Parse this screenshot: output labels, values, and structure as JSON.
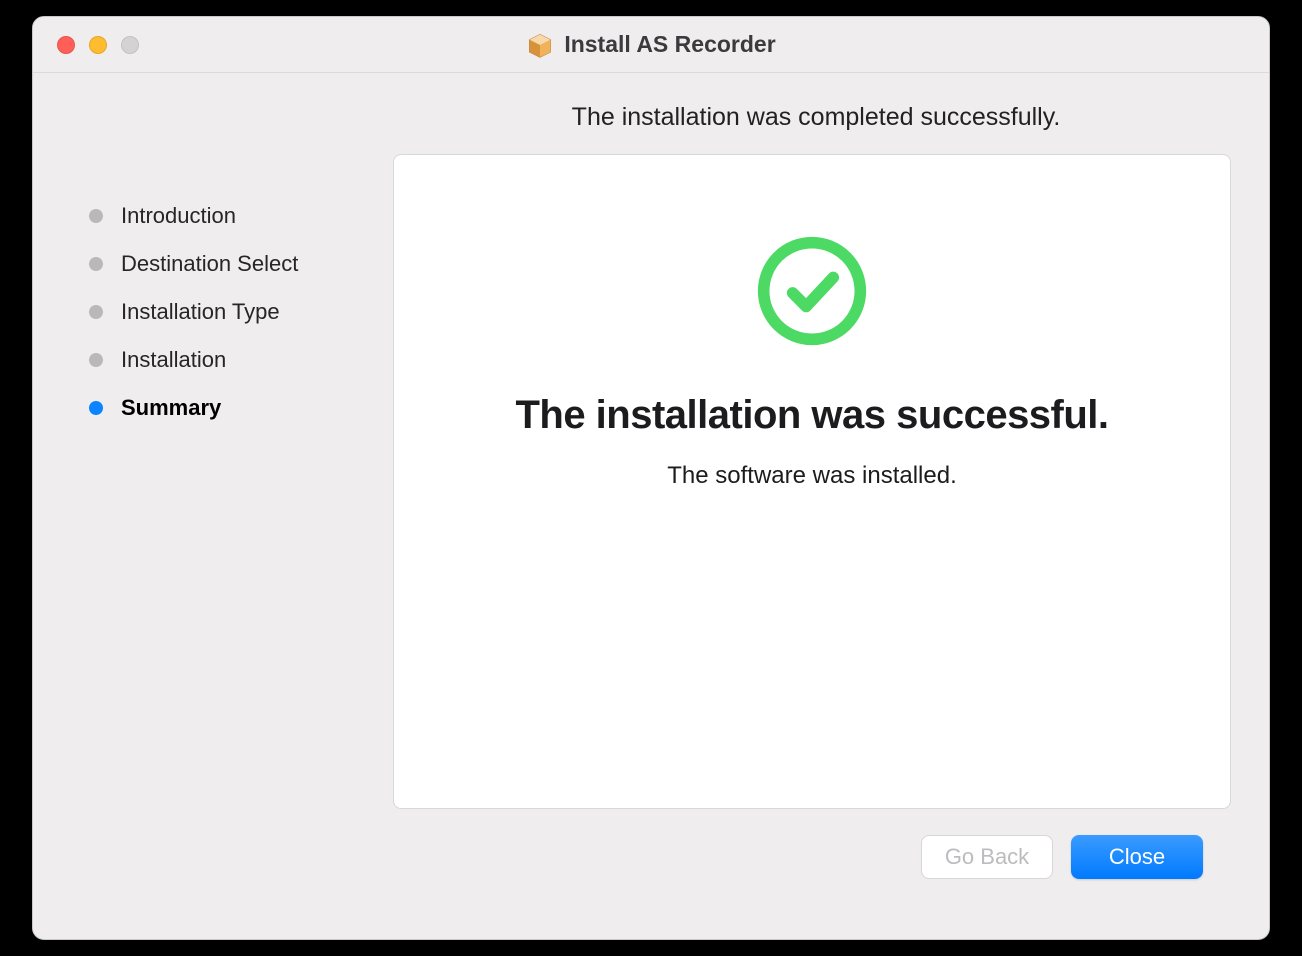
{
  "window": {
    "title": "Install AS Recorder"
  },
  "sidebar": {
    "steps": [
      {
        "label": "Introduction",
        "active": false
      },
      {
        "label": "Destination Select",
        "active": false
      },
      {
        "label": "Installation Type",
        "active": false
      },
      {
        "label": "Installation",
        "active": false
      },
      {
        "label": "Summary",
        "active": true
      }
    ]
  },
  "main": {
    "header": "The installation was completed successfully.",
    "success_heading": "The installation was successful.",
    "success_sub": "The software was installed."
  },
  "buttons": {
    "go_back": "Go Back",
    "close": "Close"
  }
}
